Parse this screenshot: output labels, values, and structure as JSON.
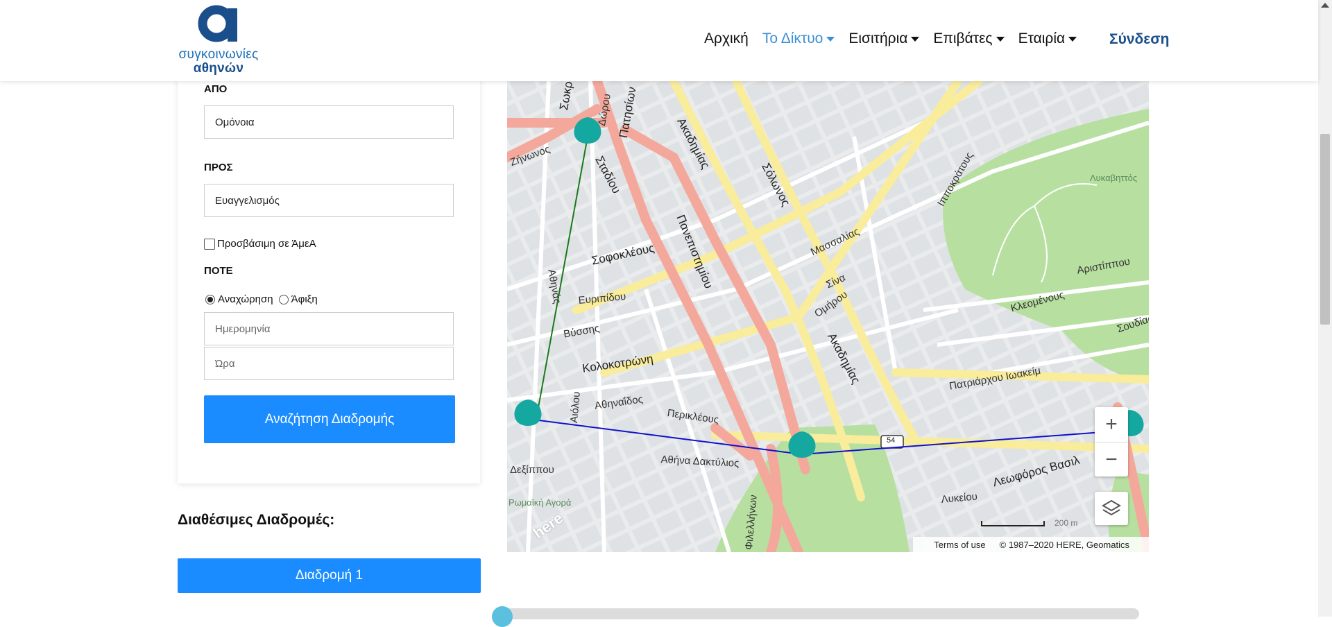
{
  "brand": {
    "line1": "συγκοινωνίες",
    "line2": "αθηνών",
    "color": "#1a4f8c"
  },
  "nav": {
    "items": [
      {
        "label": "Αρχική",
        "dropdown": false,
        "active": false
      },
      {
        "label": "Το Δίκτυο",
        "dropdown": true,
        "active": true
      },
      {
        "label": "Εισιτήρια",
        "dropdown": true,
        "active": false
      },
      {
        "label": "Επιβάτες",
        "dropdown": true,
        "active": false
      },
      {
        "label": "Εταιρία",
        "dropdown": true,
        "active": false
      }
    ],
    "login_label": "Σύνδεση"
  },
  "form": {
    "from_label": "ΑΠΟ",
    "from_value": "Ομόνοια",
    "to_label": "ΠΡΟΣ",
    "to_value": "Ευαγγελισμός",
    "accessible_label": "Προσβάσιμη σε ΆμεΑ",
    "accessible_checked": false,
    "when_label": "ΠΟΤΕ",
    "departure_label": "Αναχώρηση",
    "arrival_label": "Άφιξη",
    "selected_mode": "departure",
    "date_placeholder": "Ημερομηνία",
    "time_placeholder": "Ώρα",
    "search_button": "Αναζήτηση Διαδρομής"
  },
  "results": {
    "title": "Διαθέσιμες Διαδρομές:",
    "routes": [
      {
        "label": "Διαδρομή 1"
      }
    ]
  },
  "map": {
    "streets": {
      "sokratous": "Σωκρ",
      "patision": "Πατησίων",
      "dorou": "Δώρου",
      "akadimias1": "Ακαδημίας",
      "akadimias2": "Ακαδημίας",
      "solonos": "Σόλωνος",
      "panepistimiou": "Πανεπιστημίου",
      "stadiou": "Σταδίου",
      "zinonos": "Ζήνωνος",
      "sofokleous": "Σοφοκλέους",
      "athinas": "Αθηνάς",
      "kolokotroni": "Κολοκοτρώνη",
      "evripidou": "Ευριπίδου",
      "vyssis": "Βύσσης",
      "athinaidos": "Αθηναΐδος",
      "periklous": "Περικλέους",
      "aiolou": "Αιόλου",
      "ermou_label": "Αθήνα Δακτύλιος",
      "leoforos_vasilissis": "Λεωφόρος Βασιλ",
      "patriarchou": "Πατριάρχου Ιωακείμ",
      "lykeiou": "Λυκείου",
      "filellinon": "Φιλελλήνων",
      "romaiki_agora": "Ρωμαϊκή Αγορά",
      "lykavittos": "Λυκαβηττός",
      "aristippou": "Αριστίππου",
      "soudias": "Σουδίας",
      "kleomenous": "Κλεομένους",
      "dexippou": "Δεξίππου",
      "ippokratous": "Ιπποκράτους",
      "massalias": "Μασσαλίας",
      "sina": "Σίνα",
      "omirou": "Ομήρου",
      "road54": "54"
    },
    "scale_label": "200 m",
    "terms": "Terms of use",
    "copyright": "© 1987–2020 HERE, Geomatics",
    "provider_logo": "here",
    "colors": {
      "walk_route": "#1a7a1a",
      "transit_route": "#1010cc",
      "marker": "#14a8a0",
      "major_road": "#f4a89c",
      "secondary_road": "#f9ec9b",
      "park": "#b7e0a0"
    }
  }
}
